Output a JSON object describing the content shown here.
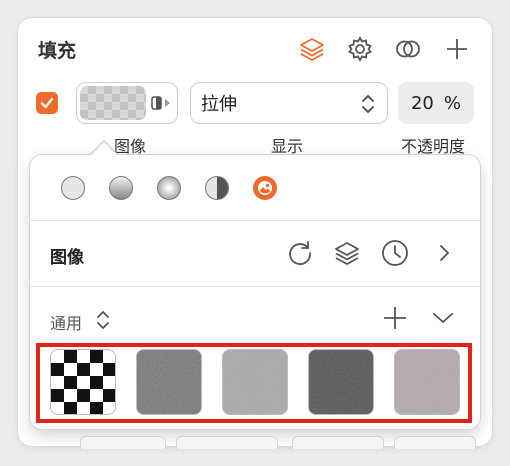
{
  "fill": {
    "title": "填充",
    "enabled": true,
    "scale_mode": "拉伸",
    "opacity_value": "20",
    "opacity_unit": "%",
    "labels": {
      "image": "图像",
      "display": "显示",
      "opacity": "不透明度"
    }
  },
  "popover": {
    "section_title": "图像",
    "group_name": "通用",
    "fill_types": [
      "solid",
      "linear-gradient",
      "radial-gradient",
      "angular-gradient",
      "image"
    ],
    "textures": [
      "checkerboard",
      "noise-gray",
      "noise-light",
      "noise-dark",
      "noise-mauve"
    ]
  },
  "colors": {
    "accent": "#f06a2a",
    "highlight": "#e0231b"
  }
}
